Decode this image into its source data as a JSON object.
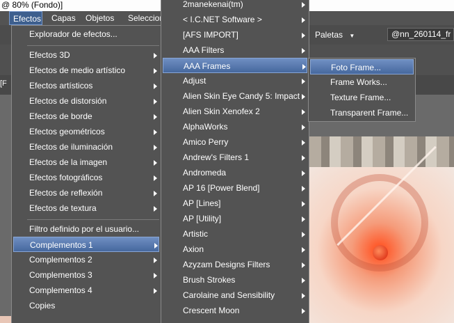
{
  "title_bar": {
    "text": "@  80% (Fondo)]"
  },
  "menubar": {
    "items": [
      "Efectos",
      "Capas",
      "Objetos",
      "Seleccion"
    ]
  },
  "toolbar": {
    "palettes_label": "Paletas",
    "file_field": "@nn_260114_fr"
  },
  "left_fragment": "[F",
  "effects_menu": {
    "items": [
      "Explorador de efectos...",
      "Efectos 3D",
      "Efectos de medio artístico",
      "Efectos artísticos",
      "Efectos de distorsión",
      "Efectos de borde",
      "Efectos geométricos",
      "Efectos de iluminación",
      "Efectos de la imagen",
      "Efectos fotográficos",
      "Efectos de reflexión",
      "Efectos de textura",
      "Filtro definido por el usuario...",
      "Complementos 1",
      "Complementos 2",
      "Complementos 3",
      "Complementos 4",
      "Copies"
    ]
  },
  "plugins_menu": {
    "items": [
      "2manekenai(tm)",
      "< I.C.NET Software >",
      "[AFS IMPORT]",
      "AAA Filters",
      "AAA Frames",
      "Adjust",
      "Alien Skin Eye Candy 5: Impact",
      "Alien Skin Xenofex 2",
      "AlphaWorks",
      "Amico Perry",
      "Andrew's Filters 1",
      "Andromeda",
      "AP 16 [Power Blend]",
      "AP [Lines]",
      "AP [Utility]",
      "Artistic",
      "Axion",
      "Azyzam Designs Filters",
      "Brush Strokes",
      "Carolaine and Sensibility",
      "Crescent Moon"
    ]
  },
  "frames_menu": {
    "items": [
      "Foto Frame...",
      "Frame Works...",
      "Texture Frame...",
      "Transparent Frame..."
    ]
  },
  "colors": {
    "highlight": "#4f72a8",
    "menu_bg": "#535353"
  }
}
